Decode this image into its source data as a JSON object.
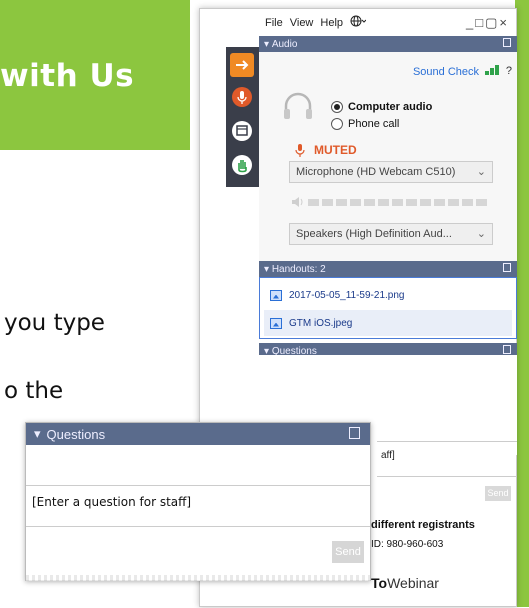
{
  "slide": {
    "banner_text": "with Us",
    "line1": "you type",
    "line2": "o the"
  },
  "menubar": {
    "file": "File",
    "view": "View",
    "help": "Help",
    "window_controls": "_□▢×"
  },
  "audio": {
    "header": "Audio",
    "sound_check": "Sound Check",
    "help_mark": "?",
    "option_computer": "Computer audio",
    "option_phone": "Phone call",
    "selected": "Computer audio",
    "muted_label": "MUTED",
    "microphone": "Microphone (HD Webcam C510)",
    "speakers": "Speakers (High Definition Aud..."
  },
  "handouts": {
    "header": "Handouts: 2",
    "files": [
      "2017-05-05_11-59-21.png",
      "GTM iOS.jpeg"
    ]
  },
  "questions": {
    "header": "Questions",
    "input_fragment": "aff]",
    "send_label": "Send"
  },
  "footer_fragments": {
    "registrants": "different registrants",
    "webinar_id": "ID: 980-960-603",
    "brand_bold": "To",
    "brand_rest": "Webinar"
  },
  "zoom_inset": {
    "header": "Questions",
    "placeholder": "[Enter a question for staff]",
    "send_label": "Send"
  },
  "colors": {
    "slide_green": "#8cc63f",
    "section_header": "#5a6b8c",
    "muted_orange": "#e05a2a",
    "link_blue": "#2a6fd6",
    "arrow_red": "#e0505a"
  }
}
